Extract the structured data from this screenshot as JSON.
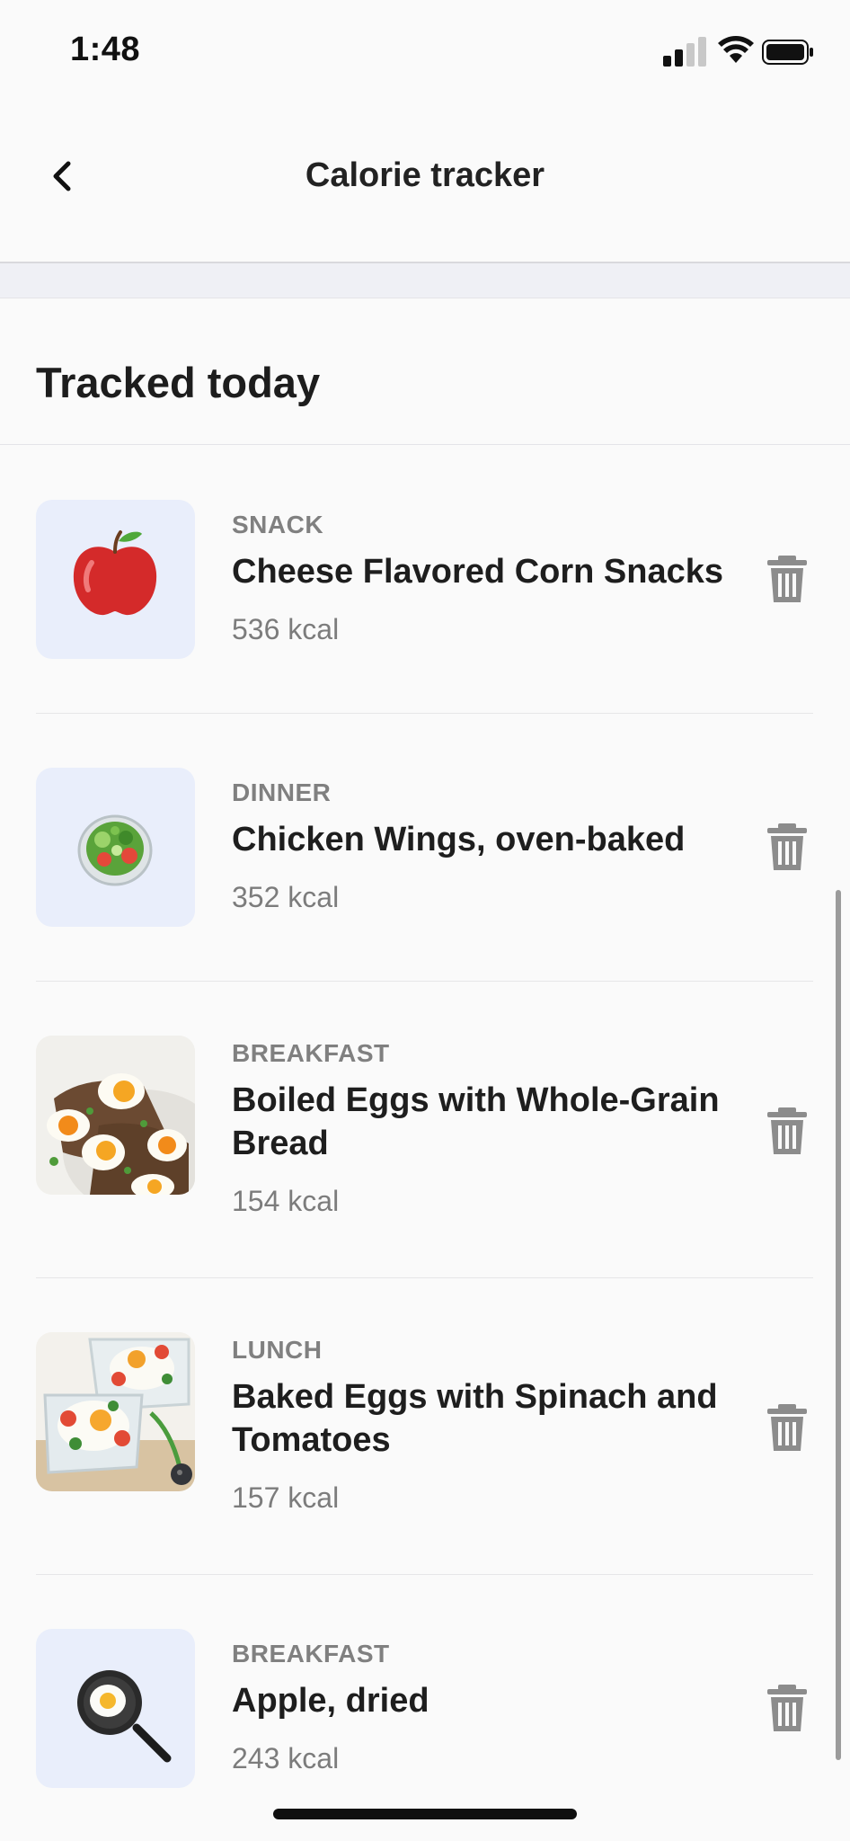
{
  "status_bar": {
    "time": "1:48"
  },
  "header": {
    "title": "Calorie tracker"
  },
  "section": {
    "title": "Tracked today"
  },
  "items": [
    {
      "meal": "SNACK",
      "name": "Cheese Flavored Corn Snacks",
      "kcal": "536 kcal",
      "icon": "apple-icon"
    },
    {
      "meal": "DINNER",
      "name": "Chicken Wings, oven-baked",
      "kcal": "352 kcal",
      "icon": "salad-icon"
    },
    {
      "meal": "BREAKFAST",
      "name": "Boiled Eggs with Whole-Grain Bread",
      "kcal": "154 kcal",
      "icon": "food-photo"
    },
    {
      "meal": "LUNCH",
      "name": "Baked Eggs with Spinach and Tomatoes",
      "kcal": "157 kcal",
      "icon": "food-photo"
    },
    {
      "meal": "BREAKFAST",
      "name": "Apple, dried",
      "kcal": "243 kcal",
      "icon": "frying-pan-icon"
    }
  ],
  "colors": {
    "thumb_bg": "#e9eefb",
    "trash": "#8c8c8c",
    "band": "#eff0f5"
  }
}
